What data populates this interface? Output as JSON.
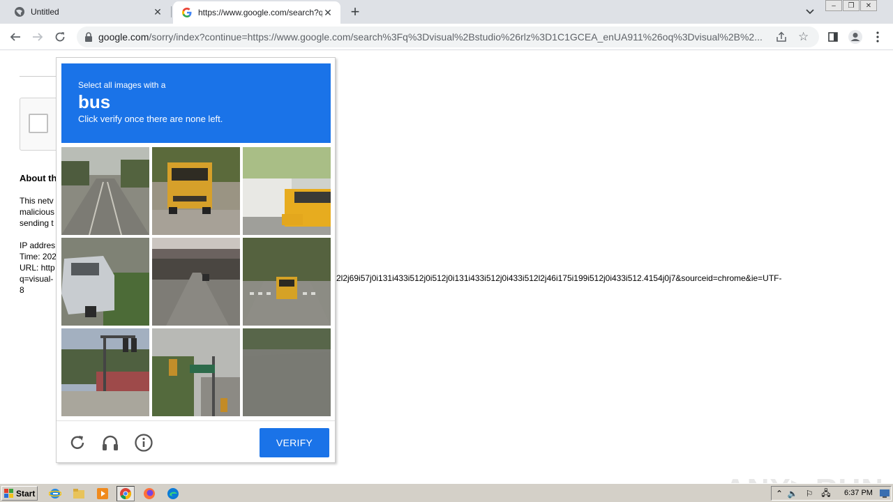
{
  "browser": {
    "tabs": [
      {
        "title": "Untitled",
        "close": "✕"
      },
      {
        "title": "https://www.google.com/search?q=",
        "close": "✕"
      }
    ],
    "new_tab": "+",
    "url_host": "google.com",
    "url_rest": "/sorry/index?continue=https://www.google.com/search%3Fq%3Dvisual%2Bstudio%26rlz%3D1C1GCEA_enUA911%26oq%3Dvisual%2B%2...",
    "star": "☆"
  },
  "page": {
    "about_heading": "About th",
    "para_lines": [
      "This netv",
      "malicious",
      "sending t"
    ],
    "info_lines": [
      "IP addres",
      "Time: 202",
      "URL: http",
      "q=visual-",
      "8"
    ],
    "url_continuation": "2l2j69i57j0i131i433i512j0i512j0i131i433i512j0i433i512l2j46i175i199i512j0i433i512.4154j0j7&sourceid=chrome&ie=UTF-"
  },
  "captcha": {
    "instruction_line1": "Select all images with a",
    "target": "bus",
    "instruction_line3": "Click verify once there are none left.",
    "verify_label": "VERIFY",
    "tiles": [
      {
        "name": "road-with-trees"
      },
      {
        "name": "school-bus-rear"
      },
      {
        "name": "school-bus-front"
      },
      {
        "name": "parked-car"
      },
      {
        "name": "tunnel-road"
      },
      {
        "name": "school-bus-intersection"
      },
      {
        "name": "traffic-light-palms"
      },
      {
        "name": "traffic-light-street-sign"
      },
      {
        "name": "empty-road"
      }
    ]
  },
  "watermark": "ANY▷RUN",
  "taskbar": {
    "start_label": "Start",
    "clock": "6:37 PM"
  }
}
